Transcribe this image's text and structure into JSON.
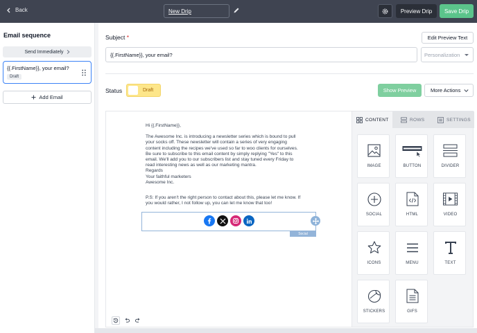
{
  "topbar": {
    "back_label": "Back",
    "drip_name": "New Drip",
    "preview_label": "Preview Drip",
    "save_label": "Save Drip"
  },
  "sidebar": {
    "title": "Email sequence",
    "send_label": "Send Immediately",
    "emails": [
      {
        "subject": "{{.FirstName}}, your email?",
        "badge": "Draft"
      }
    ],
    "add_label": "Add Email"
  },
  "main": {
    "subject_label": "Subject",
    "required_mark": "*",
    "edit_preview_label": "Edit Preview Text",
    "subject_value": "{{.FirstName}}, your email?",
    "personalization_placeholder": "Personalization",
    "status_label": "Status",
    "status_value": "Draft",
    "show_preview_label": "Show Preview",
    "more_actions_label": "More Actions"
  },
  "email_body": {
    "greeting": "Hi {{.FirstName}},",
    "paragraph": "The Awesome Inc. is introducing a newsletter series which is bound to pull\nyour socks off. These newsletter will contain a series of very engaging\ncontent including the recipes we've used so far to woo clients for ourselves.\nBe sure to subscribe to this email content by simply replying \"Yes\" to this\nemail. We'll add you to our subscribers list and stay tuned every Friday to\nread interesting news as well as our marketing mantra.\nRegards\nYour faithful marketers\nAwesome Inc.",
    "ps": "P.S: If you aren't the right person to contact about this, please let me know. If\nyou would rather, I not follow up, you can let me know that too!",
    "social_tag": "Social"
  },
  "panel": {
    "tabs": [
      "CONTENT",
      "ROWS",
      "SETTINGS"
    ],
    "tiles": [
      "IMAGE",
      "BUTTON",
      "DIVIDER",
      "SOCIAL",
      "HTML",
      "VIDEO",
      "ICONS",
      "MENU",
      "TEXT",
      "STICKERS",
      "GIFS"
    ]
  },
  "colors": {
    "topbar": "#3f4451",
    "save": "#5bc48b",
    "accent_blue": "#3b82f6",
    "draft_toggle": "#fde68a"
  }
}
